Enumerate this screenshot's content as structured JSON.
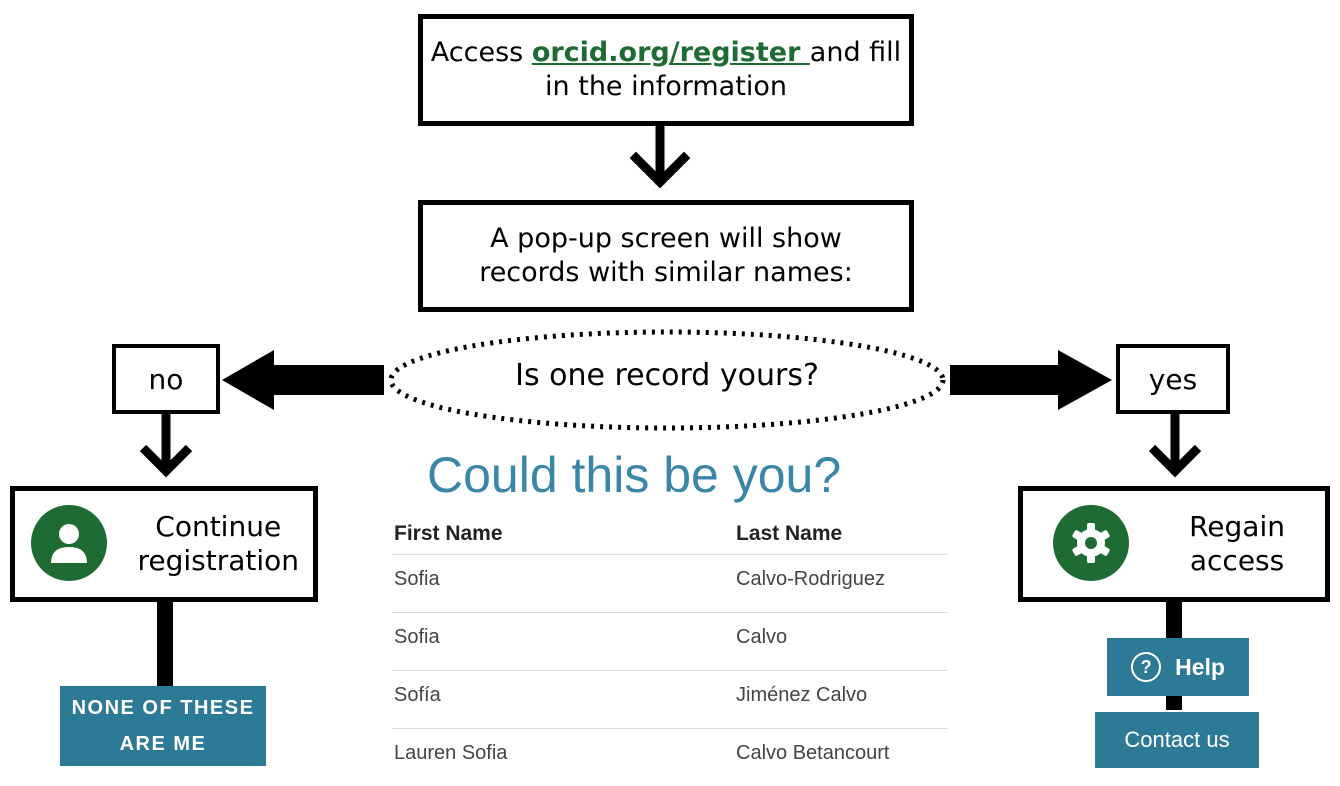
{
  "steps": {
    "access": {
      "prefix": "Access ",
      "link": "orcid.org/register ",
      "suffix": "and fill",
      "line2": "in the information"
    },
    "popup": {
      "line1": "A pop-up screen will show",
      "line2": "records with similar names:"
    },
    "question": "Is one record yours?"
  },
  "branches": {
    "no": {
      "label": "no",
      "result": {
        "line1": "Continue",
        "line2": "registration"
      },
      "icon": "person-icon",
      "button": {
        "line1": "NONE OF THESE",
        "line2": "ARE ME"
      }
    },
    "yes": {
      "label": "yes",
      "result": {
        "line1": "Regain",
        "line2": "access"
      },
      "icon": "gear-icon",
      "help_label": "Help",
      "contact_label": "Contact us"
    }
  },
  "dialog": {
    "title": "Could this be you?",
    "columns": [
      "First Name",
      "Last Name"
    ],
    "rows": [
      [
        "Sofia",
        "Calvo-Rodriguez"
      ],
      [
        "Sofia",
        "Calvo"
      ],
      [
        "Sofía",
        "Jiménez Calvo"
      ],
      [
        "Lauren Sofia",
        "Calvo Betancourt"
      ]
    ]
  },
  "colors": {
    "green": "#1e6b33",
    "teal": "#2c7a96",
    "title_teal": "#3a86a8"
  }
}
